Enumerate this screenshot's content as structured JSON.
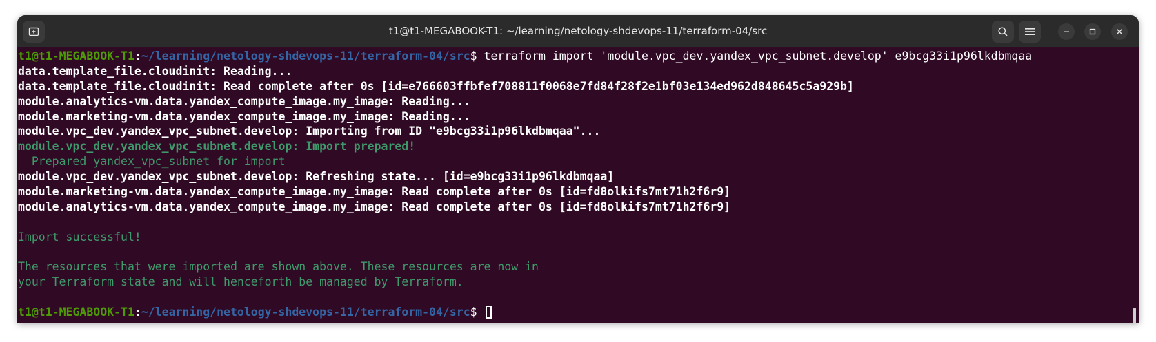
{
  "window": {
    "title": "t1@t1-MEGABOOK-T1: ~/learning/netology-shdevops-11/terraform-04/src",
    "buttons": {
      "new_tab_icon": "new-tab-icon",
      "search_icon": "search-icon",
      "menu_icon": "hamburger-menu-icon",
      "minimize_icon": "minimize-icon",
      "maximize_icon": "maximize-icon",
      "close_icon": "close-icon"
    }
  },
  "colors": {
    "background": "#300a24",
    "titlebar": "#2b2b2b",
    "prompt_user": "#4e9a06",
    "prompt_path": "#3465a4",
    "success_text": "#3f9a6b"
  },
  "terminal": {
    "prompt": {
      "user_host": "t1@t1-MEGABOOK-T1",
      "colon": ":",
      "path": "~/learning/netology-shdevops-11/terraform-04/src",
      "dollar": "$ "
    },
    "command": "terraform import 'module.vpc_dev.yandex_vpc_subnet.develop' e9bcg33i1p96lkdbmqaa",
    "lines": {
      "l1": "data.template_file.cloudinit: Reading...",
      "l2": "data.template_file.cloudinit: Read complete after 0s [id=e766603ffbfef708811f0068e7fd84f28f2e1bf03e134ed962d848645c5a929b]",
      "l3": "module.analytics-vm.data.yandex_compute_image.my_image: Reading...",
      "l4": "module.marketing-vm.data.yandex_compute_image.my_image: Reading...",
      "l5": "module.vpc_dev.yandex_vpc_subnet.develop: Importing from ID \"e9bcg33i1p96lkdbmqaa\"...",
      "l6": "module.vpc_dev.yandex_vpc_subnet.develop: Import prepared!",
      "l7": "  Prepared yandex_vpc_subnet for import",
      "l8": "module.vpc_dev.yandex_vpc_subnet.develop: Refreshing state... [id=e9bcg33i1p96lkdbmqaa]",
      "l9": "module.marketing-vm.data.yandex_compute_image.my_image: Read complete after 0s [id=fd8olkifs7mt71h2f6r9]",
      "l10": "module.analytics-vm.data.yandex_compute_image.my_image: Read complete after 0s [id=fd8olkifs7mt71h2f6r9]",
      "l11": "Import successful!",
      "l12": "The resources that were imported are shown above. These resources are now in",
      "l13": "your Terraform state and will henceforth be managed by Terraform."
    }
  }
}
